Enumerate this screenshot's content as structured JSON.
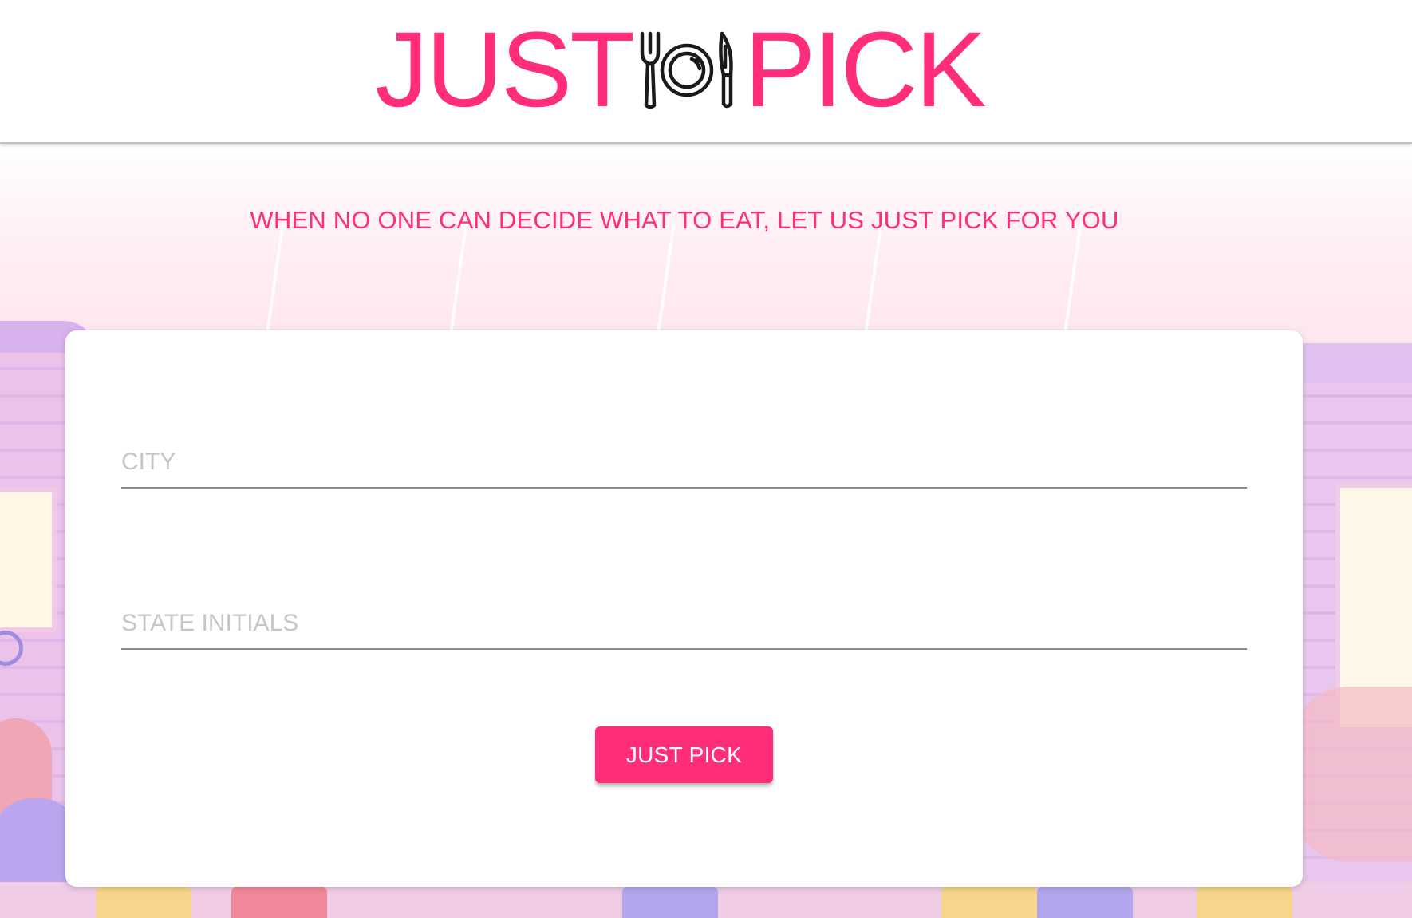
{
  "brand": {
    "logo_left": "JUST",
    "logo_right": "PICK",
    "accent_color": "#ff2d7a",
    "logo_icon": "fork-plate-knife-icon"
  },
  "tagline": "WHEN NO ONE CAN DECIDE WHAT TO EAT, LET US JUST PICK FOR YOU",
  "form": {
    "city": {
      "value": "",
      "placeholder": "CITY"
    },
    "state": {
      "value": "",
      "placeholder": "STATE INITIALS"
    },
    "submit_label": "JUST PICK"
  }
}
